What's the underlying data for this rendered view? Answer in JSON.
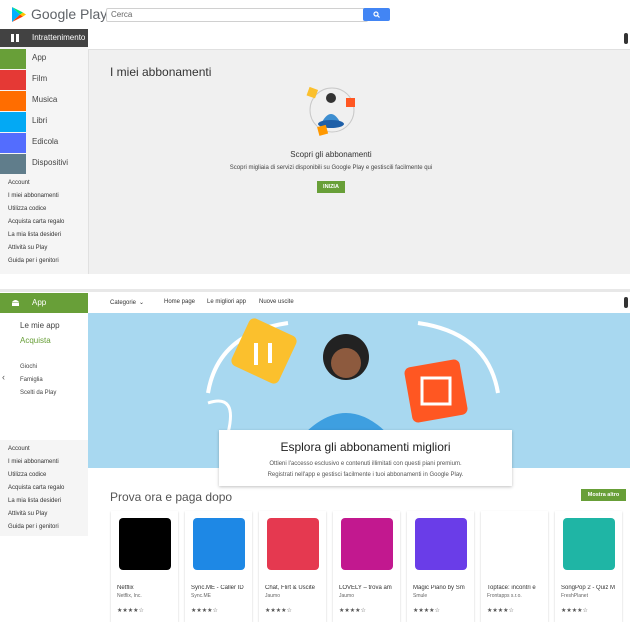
{
  "header": {
    "logo_text": "Google Play",
    "search_placeholder": "Cerca"
  },
  "sidebar_top": {
    "header_label": "Intrattenimento",
    "items": [
      {
        "label": "App",
        "color": "#689f38",
        "icon": "android-icon"
      },
      {
        "label": "Film",
        "color": "#e53935",
        "icon": "film-icon"
      },
      {
        "label": "Musica",
        "color": "#ff6d00",
        "icon": "music-icon"
      },
      {
        "label": "Libri",
        "color": "#03a9f4",
        "icon": "book-icon"
      },
      {
        "label": "Edicola",
        "color": "#536dfe",
        "icon": "newsstand-icon"
      },
      {
        "label": "Dispositivi",
        "color": "#607d8b",
        "icon": "devices-icon"
      }
    ],
    "account_links": [
      "Account",
      "I miei abbonamenti",
      "Utilizza codice",
      "Acquista carta regalo",
      "La mia lista desideri",
      "Attività su Play",
      "Guida per i genitori"
    ]
  },
  "subs": {
    "title": "I miei abbonamenti",
    "heading": "Scopri gli abbonamenti",
    "desc": "Scopri migliaia di servizi disponibili su Google Play e gestiscili facilmente qui",
    "button": "INIZIA"
  },
  "app_nav": {
    "header_label": "App",
    "categories": "Categorie",
    "links": [
      "Home page",
      "Le migliori app",
      "Nuove uscite"
    ],
    "side_links": [
      "Le mie app",
      "Acquista"
    ],
    "side_links2": [
      "Giochi",
      "Famiglia",
      "Scelti da Play"
    ],
    "account_links": [
      "Account",
      "I miei abbonamenti",
      "Utilizza codice",
      "Acquista carta regalo",
      "La mia lista desideri",
      "Attività su Play",
      "Guida per i genitori"
    ]
  },
  "promo": {
    "title": "Esplora gli abbonamenti migliori",
    "line1": "Ottieni l'accesso esclusivo e contenuti illimitati con questi piani premium.",
    "line2": "Registrati nell'app e gestisci facilmente i tuoi abbonamenti in Google Play."
  },
  "section": {
    "title": "Prova ora e paga dopo",
    "more": "Mostra altro"
  },
  "apps": [
    {
      "title": "Netflix",
      "dev": "Netflix, Inc.",
      "color": "#000000",
      "stars": "★★★★☆"
    },
    {
      "title": "Sync.ME - Caller ID",
      "dev": "Sync.ME",
      "color": "#1e88e5",
      "stars": "★★★★☆"
    },
    {
      "title": "Chat, Flirt & Uscite",
      "dev": "Jaumo",
      "color": "#e53950",
      "stars": "★★★★☆"
    },
    {
      "title": "LOVELY – trova am",
      "dev": "Jaumo",
      "color": "#c2188f",
      "stars": "★★★★☆"
    },
    {
      "title": "Magic Piano by Sm",
      "dev": "Smule",
      "color": "#6a3de8",
      "stars": "★★★★☆"
    },
    {
      "title": "Topface: incontri e",
      "dev": "Frontapps s.r.o.",
      "color": "#ffffff",
      "stars": "★★★★☆"
    },
    {
      "title": "SongPop 2 - Quiz M",
      "dev": "FreshPlanet",
      "color": "#1fb5a5",
      "stars": "★★★★☆"
    }
  ]
}
